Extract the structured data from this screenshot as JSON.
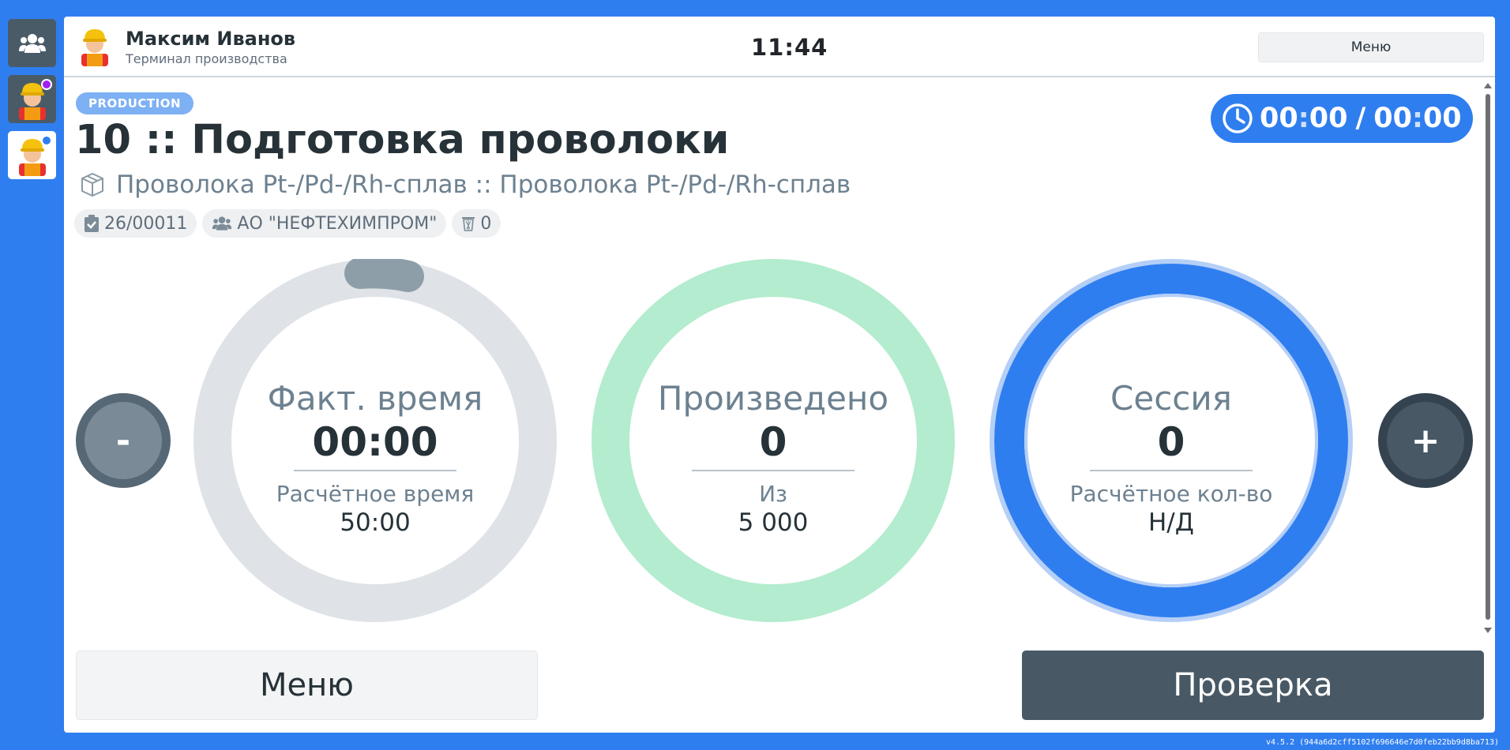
{
  "sidebar": {
    "items": [
      {
        "name": "group",
        "icon": "users-group-icon"
      },
      {
        "name": "worker-1",
        "icon": "worker-avatar-icon",
        "dot_color": "#a020f0"
      },
      {
        "name": "worker-2",
        "icon": "worker-avatar-icon",
        "dot_color": "#2f7ef0"
      }
    ]
  },
  "header": {
    "user_name": "Максим Иванов",
    "subtitle": "Терминал производства",
    "clock": "11:44",
    "menu_label": "Меню"
  },
  "operation": {
    "status_badge": "PRODUCTION",
    "title": "10 :: Подготовка проволоки",
    "product": "Проволока Pt-/Pd-/Rh-сплав :: Проволока Pt-/Pd-/Rh-сплав",
    "order_no": "26/00011",
    "customer": "АО \"НЕФТЕХИМПРОМ\"",
    "scrap": "0"
  },
  "timer": {
    "actual_mm": "00",
    "actual_ss": "00",
    "planned_mm": "00",
    "planned_ss": "00",
    "separator": ":",
    "slash": "/"
  },
  "gauges": {
    "time": {
      "label": "Факт. время",
      "value": "00:00",
      "sub_label": "Расчётное время",
      "sub_value": "50:00"
    },
    "produced": {
      "label": "Произведено",
      "value": "0",
      "sub_label": "Из",
      "sub_value": "5 000"
    },
    "session": {
      "label": "Сессия",
      "value": "0",
      "sub_label": "Расчётное кол-во",
      "sub_value": "Н/Д"
    }
  },
  "controls": {
    "minus": "-",
    "plus": "+",
    "menu_button": "Меню",
    "check_button": "Проверка"
  },
  "version": "v4.5.2 (944a6d2cff5102f696646e7d0feb22bb9d8ba713)",
  "colors": {
    "accent": "#2f7ef0",
    "dark": "#485965",
    "time_ring": "#dfe3e7",
    "produced_ring": "#b3ecce",
    "session_ring": "#2f7ef0"
  }
}
